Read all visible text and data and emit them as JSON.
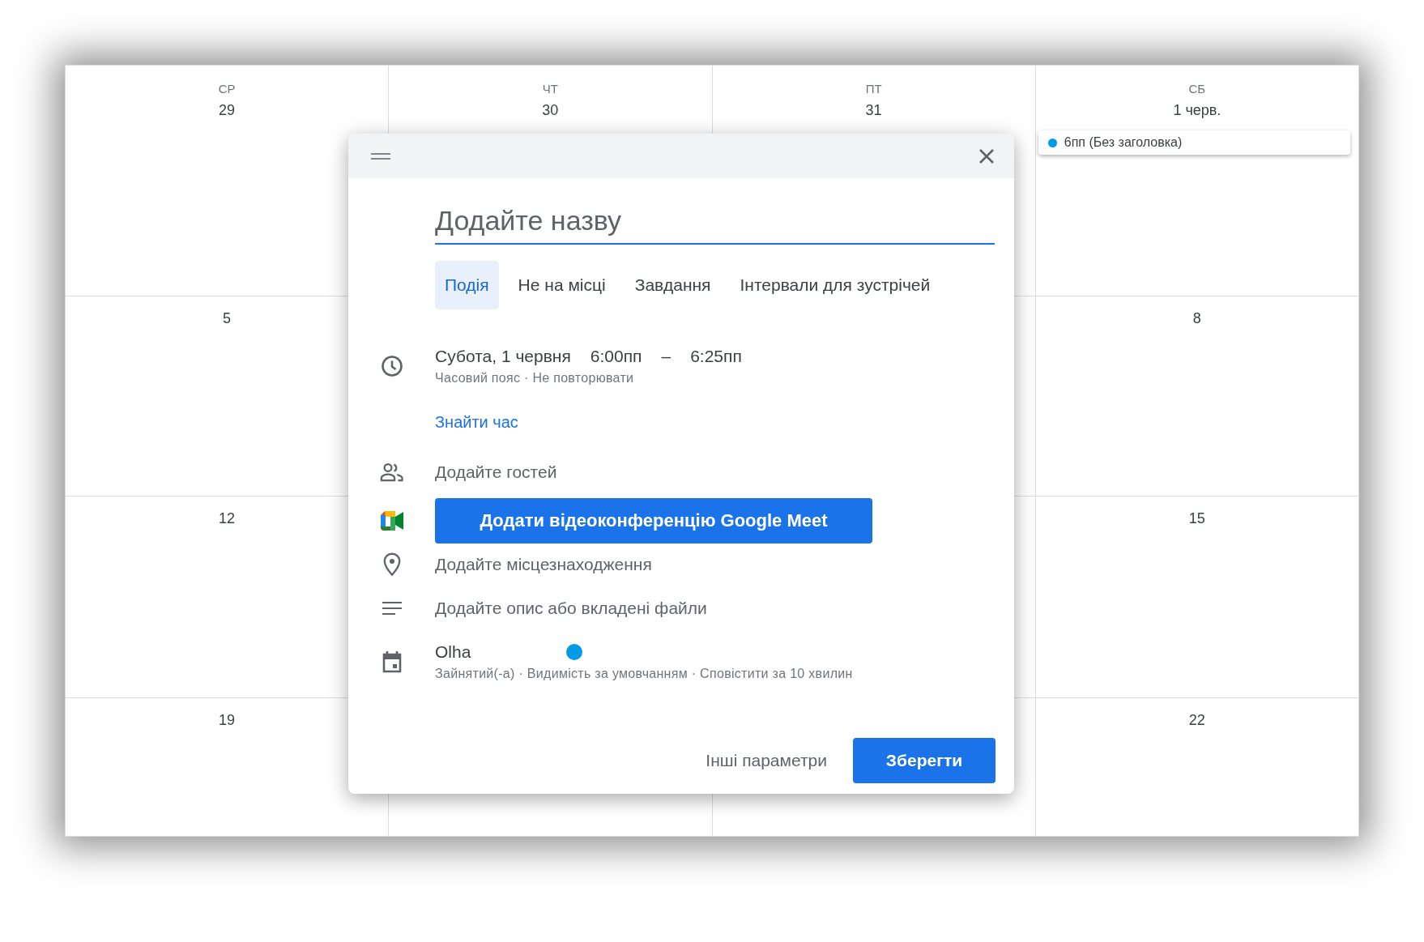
{
  "calendar": {
    "columns": [
      {
        "weekday": "СР",
        "date": "29"
      },
      {
        "weekday": "ЧТ",
        "date": "30"
      },
      {
        "weekday": "ПТ",
        "date": "31"
      },
      {
        "weekday": "СБ",
        "date": "1 черв.",
        "events": [
          {
            "title": "6пп (Без заголовка)",
            "color": "#039be5"
          }
        ]
      }
    ],
    "weeks": [
      {
        "wednesday": "5",
        "saturday": "8"
      },
      {
        "wednesday": "12",
        "saturday": "15"
      },
      {
        "wednesday": "19",
        "saturday": "22"
      }
    ]
  },
  "dialog": {
    "title": {
      "placeholder": "Додайте назву"
    },
    "tabs": [
      {
        "label": "Подія",
        "selected": true
      },
      {
        "label": "Не на місці",
        "selected": false
      },
      {
        "label": "Завдання",
        "selected": false
      },
      {
        "label": "Інтервали для зустрічей",
        "selected": false
      }
    ],
    "date": "Субота, 1 червня",
    "start": "6:00пп",
    "dash": "–",
    "end": "6:25пп",
    "date_options": "Часовий пояс · Не повторювати",
    "find_time": "Знайти час",
    "rows": [
      {
        "kind": "field",
        "placeholder": "Додайте гостей"
      },
      {
        "kind": "button",
        "label": "Додати відеоконференцію Google Meet"
      },
      {
        "kind": "field",
        "placeholder": "Додайте місцезнаходження"
      },
      {
        "kind": "field",
        "placeholder": "Додайте опис або вкладені файли"
      }
    ],
    "calendar": {
      "name": "Olha",
      "color": "#039be5",
      "details": "Зайнятий(-а) · Видимість за умовчанням · Сповістити за 10 хвилин"
    },
    "more_options": "Інші параметри",
    "save": "Зберегти"
  }
}
